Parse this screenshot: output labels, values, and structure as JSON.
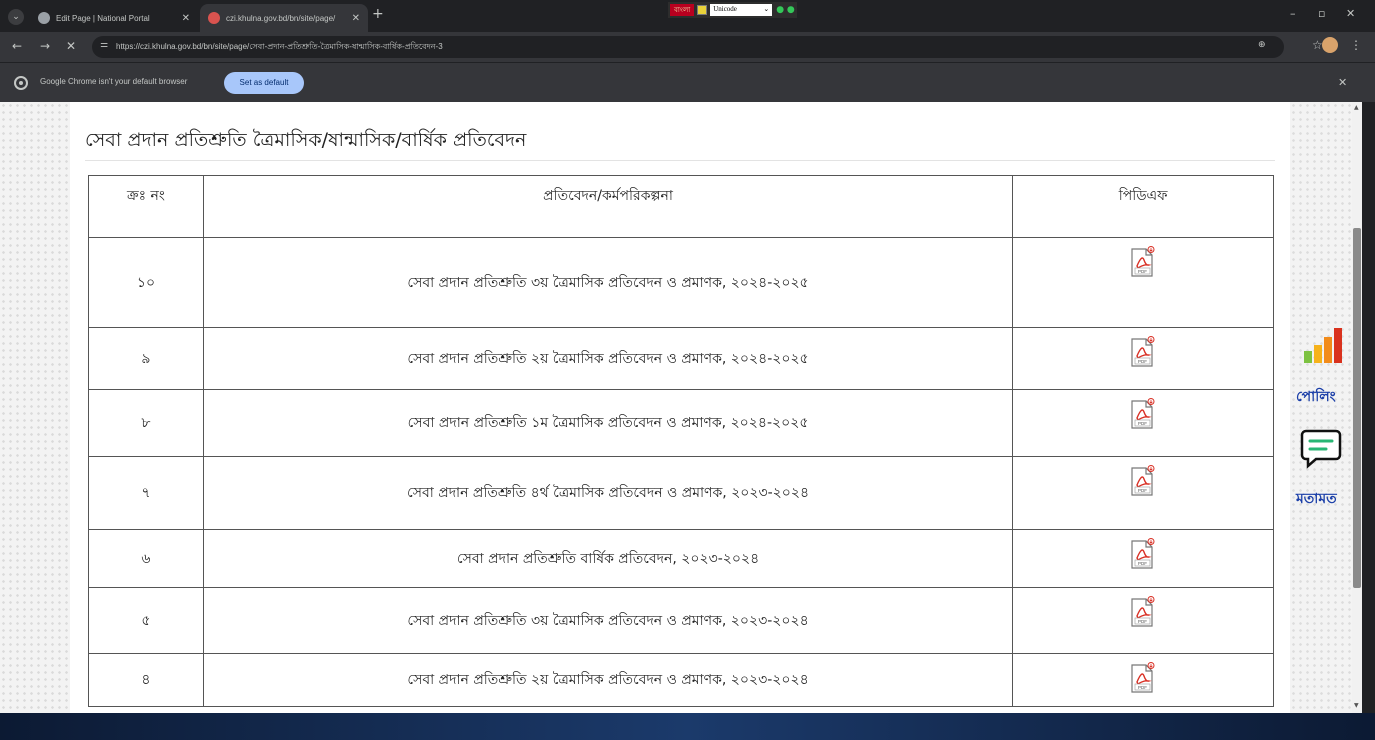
{
  "browser": {
    "tabs": [
      {
        "title": "Edit Page | National Portal",
        "active": false
      },
      {
        "title": "czi.khulna.gov.bd/bn/site/page/",
        "active": true
      }
    ],
    "new_tab_glyph": "+",
    "ime": {
      "label": "বাংলা",
      "input_method": "Unicode"
    },
    "window_controls": {
      "minimize": "–",
      "maximize": "▫",
      "close": "✕"
    },
    "nav": {
      "back": "←",
      "forward": "→",
      "stop": "✕"
    },
    "url": "https://czi.khulna.gov.bd/bn/site/page/সেবা-প্রদান-প্রতিশ্রুতি-ত্রৈমাসিক-ষান্মাসিক-বার্ষিক-প্রতিবেদন-3",
    "infobar": {
      "message": "Google Chrome isn't your default browser",
      "button": "Set as default",
      "close": "✕"
    }
  },
  "page": {
    "title": "সেবা প্রদান প্রতিশ্রুতি ত্রৈমাসিক/ষান্মাসিক/বার্ষিক প্রতিবেদন",
    "table": {
      "headers": [
        "ক্রঃ নং",
        "প্রতিবেদন/কর্মপরিকল্পনা",
        "পিডিএফ"
      ],
      "rows": [
        {
          "no": "১০",
          "report": "সেবা প্রদান প্রতিশ্রুতি ৩য় ত্রৈমাসিক প্রতিবেদন ও প্রমাণক, ২০২৪-২০২৫"
        },
        {
          "no": "৯",
          "report": "সেবা প্রদান প্রতিশ্রুতি ২য় ত্রৈমাসিক প্রতিবেদন ও প্রমাণক, ২০২৪-২০২৫"
        },
        {
          "no": "৮",
          "report": "সেবা প্রদান প্রতিশ্রুতি ১ম ত্রৈমাসিক প্রতিবেদন ও প্রমাণক, ২০২৪-২০২৫"
        },
        {
          "no": "৭",
          "report": "সেবা প্রদান প্রতিশ্রুতি ৪র্থ  ত্রৈমাসিক প্রতিবেদন ও প্রমাণক, ২০২৩-২০২৪"
        },
        {
          "no": "৬",
          "report": "সেবা প্রদান প্রতিশ্রুতি বার্ষিক প্রতিবেদন, ২০২৩-২০২৪"
        },
        {
          "no": "৫",
          "report": "সেবা প্রদান প্রতিশ্রুতি ৩য় ত্রৈমাসিক প্রতিবেদন ও প্রমাণক, ২০২৩-২০২৪"
        },
        {
          "no": "৪",
          "report": "সেবা প্রদান প্রতিশ্রুতি ২য় ত্রৈমাসিক প্রতিবেদন ও প্রমাণক, ২০২৩-২০২৪"
        }
      ],
      "pdf_icon_text": "PDF"
    },
    "widgets": {
      "poll_label": "পোলিং",
      "feedback_label": "মতামত"
    }
  },
  "colors": {
    "chrome_dark": "#202124",
    "chrome_toolbar": "#35363a",
    "accent_blue": "#a8c7fa",
    "widget_label": "#1a3ea8",
    "pdf_red": "#d93025"
  }
}
